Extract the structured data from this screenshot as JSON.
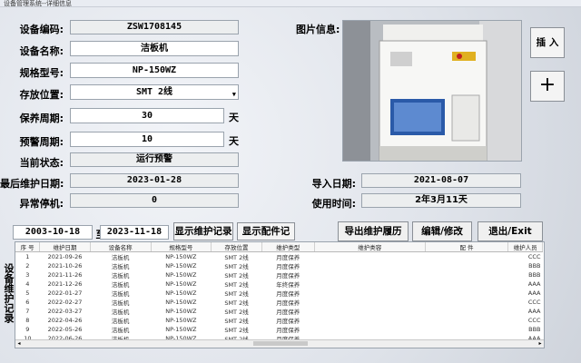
{
  "window": {
    "title": "设备管理系统--详细信息"
  },
  "form": {
    "code_label": "设备编码:",
    "code_value": "ZSW1708145",
    "name_label": "设备名称:",
    "name_value": "洁板机",
    "model_label": "规格型号:",
    "model_value": "NP-150WZ",
    "location_label": "存放位置:",
    "location_value": "SMT 2线",
    "maint_label": "保养周期:",
    "maint_value": "30",
    "maint_unit": "天",
    "warn_label": "预警周期:",
    "warn_value": "10",
    "warn_unit": "天",
    "status_label": "当前状态:",
    "status_value": "运行预警",
    "last_label": "最后维护日期:",
    "last_value": "2023-01-28",
    "abnormal_label": "异常停机:",
    "abnormal_value": "0",
    "image_label": "图片信息:",
    "import_label": "导入日期:",
    "import_value": "2021-08-07",
    "use_label": "使用时间:",
    "use_value": "2年3月11天"
  },
  "buttons": {
    "insert": "插 入",
    "plus": "+",
    "show_maint": "显示维护记录",
    "show_parts": "显示配件记录",
    "export": "导出维护履历",
    "edit": "编辑/修改",
    "exit": "退出/Exit"
  },
  "filter": {
    "from": "2003-10-18",
    "to_label": "至",
    "to": "2023-11-18"
  },
  "side_title": "设备维护记录",
  "table": {
    "headers": [
      "序 号",
      "维护日期",
      "设备名称",
      "规格型号",
      "存放位置",
      "维护类型",
      "维护类容",
      "配 件",
      "维护人员"
    ],
    "rows": [
      [
        "1",
        "2021-09-26",
        "洁板机",
        "NP-150WZ",
        "SMT 2线",
        "月度保养",
        "",
        "",
        "CCC"
      ],
      [
        "2",
        "2021-10-26",
        "洁板机",
        "NP-150WZ",
        "SMT 2线",
        "月度保养",
        "",
        "",
        "BBB"
      ],
      [
        "3",
        "2021-11-26",
        "洁板机",
        "NP-150WZ",
        "SMT 2线",
        "月度保养",
        "",
        "",
        "BBB"
      ],
      [
        "4",
        "2021-12-26",
        "洁板机",
        "NP-150WZ",
        "SMT 2线",
        "年终保养",
        "",
        "",
        "AAA"
      ],
      [
        "5",
        "2022-01-27",
        "洁板机",
        "NP-150WZ",
        "SMT 2线",
        "月度保养",
        "",
        "",
        "AAA"
      ],
      [
        "6",
        "2022-02-27",
        "洁板机",
        "NP-150WZ",
        "SMT 2线",
        "月度保养",
        "",
        "",
        "CCC"
      ],
      [
        "7",
        "2022-03-27",
        "洁板机",
        "NP-150WZ",
        "SMT 2线",
        "月度保养",
        "",
        "",
        "AAA"
      ],
      [
        "8",
        "2022-04-26",
        "洁板机",
        "NP-150WZ",
        "SMT 2线",
        "月度保养",
        "",
        "",
        "CCC"
      ],
      [
        "9",
        "2022-05-26",
        "洁板机",
        "NP-150WZ",
        "SMT 2线",
        "月度保养",
        "",
        "",
        "BBB"
      ],
      [
        "10",
        "2022-06-26",
        "洁板机",
        "NP-150WZ",
        "SMT 2线",
        "月度保养",
        "",
        "",
        "AAA"
      ],
      [
        "11",
        "2022-12-24",
        "洁板机",
        "NP-150WZ",
        "SMT 2线",
        "年终保养",
        "",
        "",
        "BBB"
      ],
      [
        "12",
        "2023-01-28",
        "洁板机",
        "NP-150WZ",
        "SMT 2线",
        "月度保养",
        "润滑",
        "",
        "AAA"
      ]
    ]
  }
}
